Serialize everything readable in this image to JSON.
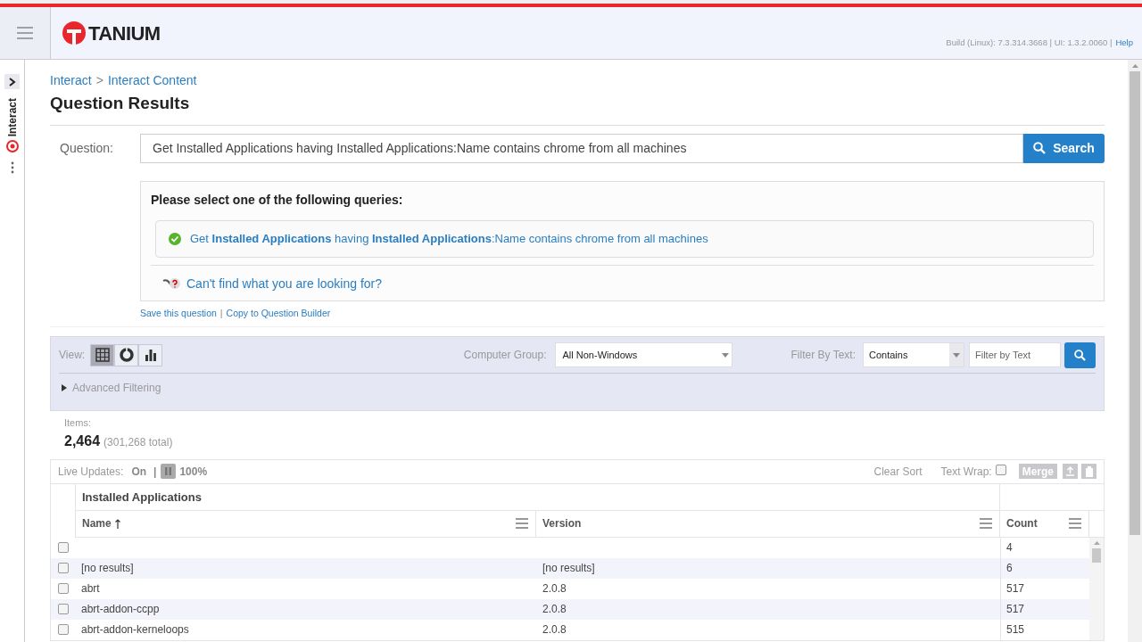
{
  "header": {
    "logo_text": "TANIUM",
    "build_info": "Build (Linux): 7.3.314.3668 | UI: 1.3.2.0060 |",
    "help_link": "Help"
  },
  "sidebar": {
    "tab_label": "Interact"
  },
  "breadcrumb": {
    "items": [
      "Interact",
      "Interact Content"
    ],
    "separator": ">"
  },
  "page_title": "Question Results",
  "question": {
    "label": "Question:",
    "value": "Get Installed Applications having Installed Applications:Name contains chrome from all machines",
    "search_button": "Search"
  },
  "queries": {
    "heading": "Please select one of the following queries:",
    "options": [
      {
        "text": "Get **Installed Applications** having **Installed Applications**:Name contains chrome from all machines",
        "selected": true
      }
    ],
    "help_link": "Can't find what you are looking for?"
  },
  "question_links": {
    "items": [
      "Save this question",
      "Copy to Question Builder"
    ],
    "separator": "|"
  },
  "filters": {
    "view_label": "View:",
    "views": [
      {
        "kind": "grid",
        "selected": true
      },
      {
        "kind": "pie",
        "selected": false
      },
      {
        "kind": "bar",
        "selected": false
      }
    ],
    "computer_group_label": "Computer Group:",
    "computer_group": "All Non-Windows",
    "filter_label": "Filter By Text:",
    "filter_mode": "Contains",
    "filter_placeholder": "Filter by Text",
    "advanced": {
      "label": "Advanced Filtering",
      "expanded": false
    }
  },
  "items": {
    "label": "Items:",
    "count": "2,464",
    "total": "(301,268 total)"
  },
  "toolbar": {
    "live_label": "Live Updates:",
    "live_state": "On",
    "separator": "|",
    "progress": "100%",
    "clear_sort": "Clear Sort",
    "text_wrap_label": "Text Wrap:",
    "text_wrap": false,
    "merge": "Merge"
  },
  "table": {
    "group_title": "Installed Applications",
    "columns": [
      {
        "label": "Name",
        "sorted": true
      },
      {
        "label": "Version",
        "sorted": false
      },
      {
        "label": "Count",
        "sorted": false
      }
    ],
    "rows": [
      {
        "count": "4",
        "checked": false
      },
      {
        "name": "[no results]",
        "version": "[no results]",
        "count": "6",
        "checked": false
      },
      {
        "name": "abrt",
        "version": "2.0.8",
        "count": "517",
        "checked": false
      },
      {
        "name": "abrt-addon-ccpp",
        "version": "2.0.8",
        "count": "517",
        "checked": false
      },
      {
        "name": "abrt-addon-kerneloops",
        "version": "2.0.8",
        "count": "515",
        "checked": false
      }
    ]
  }
}
